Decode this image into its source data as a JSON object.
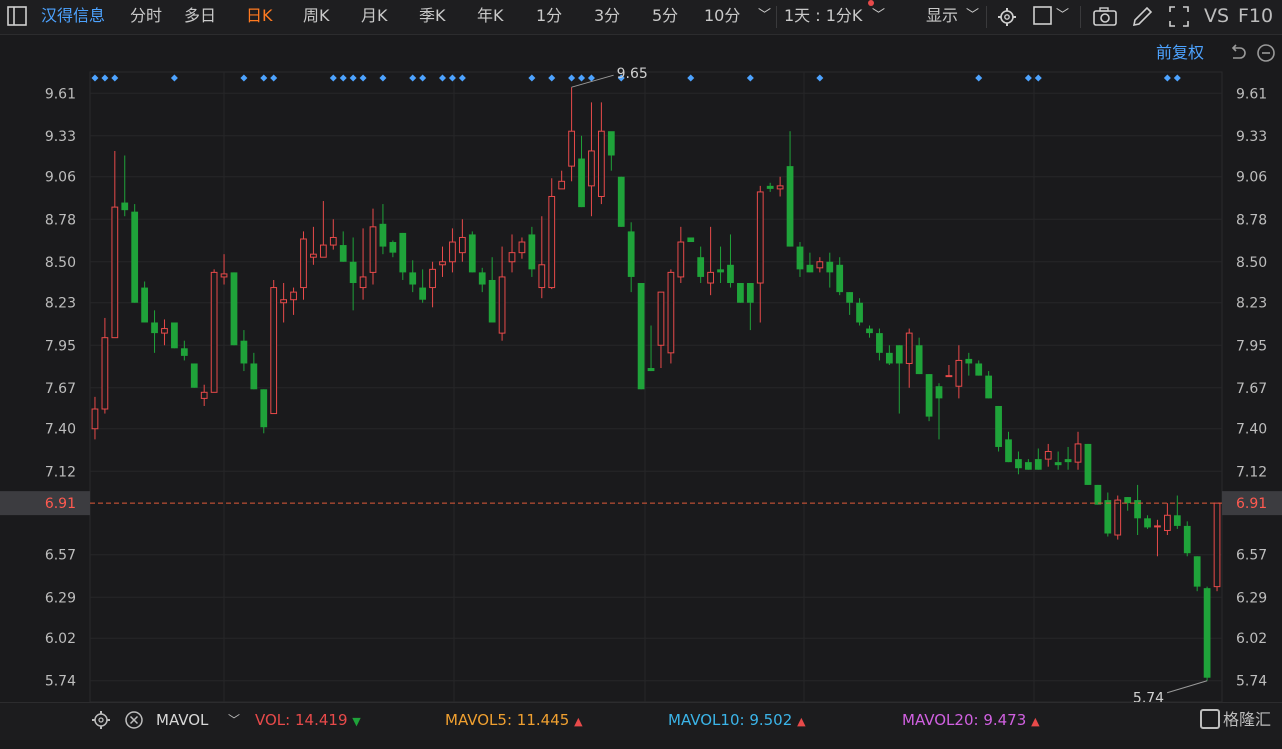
{
  "toolbar": {
    "stock_name": "汉得信息",
    "tabs": [
      "分时",
      "多日",
      "日K",
      "周K",
      "月K",
      "季K",
      "年K",
      "1分",
      "3分",
      "5分",
      "10分"
    ],
    "active_tab": "日K",
    "period_select": "1天 : 1分K",
    "display_label": "显示",
    "vs_label": "VS",
    "f10_label": "F10"
  },
  "subbar": {
    "adjust_label": "前复权"
  },
  "colors": {
    "up": "#e84a4a",
    "down": "#1fa33a",
    "active_tab": "#ff7a20",
    "accent": "#4da3ff",
    "price_line": "#e05a3a",
    "mavol5": "#f0a030",
    "mavol10": "#3bb4e8",
    "mavol20": "#d060e0"
  },
  "chart_data": {
    "type": "candlestick",
    "yaxis_ticks": [
      "9.61",
      "9.33",
      "9.06",
      "8.78",
      "8.50",
      "8.23",
      "7.95",
      "7.67",
      "7.40",
      "7.12",
      "6.57",
      "6.29",
      "6.02",
      "5.74"
    ],
    "ylim": [
      5.6,
      9.75
    ],
    "current_price": "6.91",
    "high_label": "9.65",
    "low_label": "5.74",
    "candles": [
      [
        7.4,
        7.53,
        7.33,
        7.61
      ],
      [
        7.53,
        8.0,
        7.5,
        8.13
      ],
      [
        8.0,
        8.86,
        8.0,
        9.23
      ],
      [
        8.89,
        8.84,
        8.8,
        9.2
      ],
      [
        8.83,
        8.23,
        8.23,
        8.88
      ],
      [
        8.33,
        8.1,
        8.1,
        8.37
      ],
      [
        8.1,
        8.03,
        7.9,
        8.18
      ],
      [
        8.03,
        8.06,
        7.95,
        8.12
      ],
      [
        8.1,
        7.93,
        7.93,
        8.1
      ],
      [
        7.93,
        7.88,
        7.85,
        7.98
      ],
      [
        7.83,
        7.67,
        7.67,
        7.83
      ],
      [
        7.6,
        7.64,
        7.55,
        7.69
      ],
      [
        7.64,
        8.43,
        7.64,
        8.45
      ],
      [
        8.4,
        8.42,
        8.35,
        8.55
      ],
      [
        8.43,
        7.95,
        7.95,
        8.43
      ],
      [
        7.98,
        7.83,
        7.78,
        8.05
      ],
      [
        7.83,
        7.66,
        7.66,
        7.9
      ],
      [
        7.66,
        7.41,
        7.37,
        7.66
      ],
      [
        7.5,
        8.33,
        7.5,
        8.38
      ],
      [
        8.23,
        8.25,
        8.1,
        8.36
      ],
      [
        8.25,
        8.3,
        8.15,
        8.33
      ],
      [
        8.33,
        8.65,
        8.25,
        8.7
      ],
      [
        8.53,
        8.55,
        8.48,
        8.73
      ],
      [
        8.53,
        8.61,
        8.53,
        8.9
      ],
      [
        8.61,
        8.66,
        8.58,
        8.78
      ],
      [
        8.61,
        8.5,
        8.5,
        8.7
      ],
      [
        8.5,
        8.36,
        8.18,
        8.66
      ],
      [
        8.33,
        8.4,
        8.25,
        8.72
      ],
      [
        8.43,
        8.73,
        8.35,
        8.85
      ],
      [
        8.75,
        8.6,
        8.55,
        8.88
      ],
      [
        8.63,
        8.56,
        8.53,
        8.64
      ],
      [
        8.69,
        8.43,
        8.38,
        8.69
      ],
      [
        8.43,
        8.35,
        8.3,
        8.51
      ],
      [
        8.33,
        8.25,
        8.23,
        8.45
      ],
      [
        8.33,
        8.45,
        8.2,
        8.5
      ],
      [
        8.48,
        8.5,
        8.4,
        8.6
      ],
      [
        8.5,
        8.63,
        8.43,
        8.72
      ],
      [
        8.56,
        8.66,
        8.5,
        8.78
      ],
      [
        8.68,
        8.43,
        8.43,
        8.7
      ],
      [
        8.43,
        8.35,
        8.3,
        8.46
      ],
      [
        8.38,
        8.1,
        8.1,
        8.53
      ],
      [
        8.03,
        8.4,
        7.98,
        8.6
      ],
      [
        8.5,
        8.56,
        8.43,
        8.68
      ],
      [
        8.56,
        8.63,
        8.52,
        8.66
      ],
      [
        8.68,
        8.45,
        8.4,
        8.73
      ],
      [
        8.33,
        8.48,
        8.26,
        8.8
      ],
      [
        8.33,
        8.93,
        8.32,
        9.05
      ],
      [
        8.98,
        9.03,
        8.98,
        9.1
      ],
      [
        9.13,
        9.36,
        9.03,
        9.65
      ],
      [
        9.18,
        8.86,
        8.86,
        9.33
      ],
      [
        9.0,
        9.23,
        8.8,
        9.55
      ],
      [
        8.93,
        9.36,
        8.88,
        9.55
      ],
      [
        9.36,
        9.2,
        9.1,
        9.2
      ],
      [
        9.06,
        8.73,
        8.73,
        9.06
      ],
      [
        8.7,
        8.4,
        8.3,
        8.76
      ],
      [
        8.36,
        7.66,
        7.66,
        8.36
      ],
      [
        7.8,
        7.78,
        7.78,
        8.08
      ],
      [
        7.95,
        8.3,
        7.8,
        8.3
      ],
      [
        7.9,
        8.43,
        7.83,
        8.45
      ],
      [
        8.4,
        8.63,
        8.36,
        8.73
      ],
      [
        8.66,
        8.63,
        8.63,
        8.65
      ],
      [
        8.53,
        8.4,
        8.36,
        8.6
      ],
      [
        8.36,
        8.43,
        8.28,
        8.73
      ],
      [
        8.45,
        8.43,
        8.36,
        8.6
      ],
      [
        8.48,
        8.36,
        8.33,
        8.68
      ],
      [
        8.36,
        8.23,
        8.23,
        8.36
      ],
      [
        8.36,
        8.23,
        8.05,
        8.36
      ],
      [
        8.36,
        8.96,
        8.1,
        9.0
      ],
      [
        9.0,
        8.98,
        8.96,
        9.02
      ],
      [
        8.98,
        9.0,
        8.93,
        9.06
      ],
      [
        9.13,
        8.6,
        8.6,
        9.36
      ],
      [
        8.6,
        8.45,
        8.4,
        8.63
      ],
      [
        8.48,
        8.43,
        8.43,
        8.56
      ],
      [
        8.46,
        8.5,
        8.43,
        8.53
      ],
      [
        8.5,
        8.43,
        8.33,
        8.56
      ],
      [
        8.48,
        8.3,
        8.28,
        8.53
      ],
      [
        8.3,
        8.23,
        8.15,
        8.3
      ],
      [
        8.23,
        8.1,
        8.08,
        8.26
      ],
      [
        8.06,
        8.03,
        8.0,
        8.08
      ],
      [
        8.03,
        7.9,
        7.85,
        8.06
      ],
      [
        7.9,
        7.83,
        7.82,
        7.95
      ],
      [
        7.95,
        7.83,
        7.5,
        7.95
      ],
      [
        7.83,
        8.03,
        7.67,
        8.06
      ],
      [
        7.95,
        7.76,
        7.76,
        8.0
      ],
      [
        7.76,
        7.48,
        7.45,
        7.76
      ],
      [
        7.68,
        7.6,
        7.33,
        7.7
      ],
      [
        7.75,
        7.75,
        7.75,
        7.82
      ],
      [
        7.68,
        7.85,
        7.6,
        7.95
      ],
      [
        7.86,
        7.83,
        7.75,
        7.9
      ],
      [
        7.83,
        7.75,
        7.75,
        7.85
      ],
      [
        7.75,
        7.6,
        7.6,
        7.78
      ],
      [
        7.55,
        7.28,
        7.25,
        7.55
      ],
      [
        7.33,
        7.18,
        7.18,
        7.38
      ],
      [
        7.2,
        7.14,
        7.1,
        7.25
      ],
      [
        7.18,
        7.13,
        7.13,
        7.2
      ],
      [
        7.2,
        7.13,
        7.13,
        7.27
      ],
      [
        7.2,
        7.25,
        7.15,
        7.3
      ],
      [
        7.18,
        7.16,
        7.13,
        7.25
      ],
      [
        7.2,
        7.18,
        7.13,
        7.28
      ],
      [
        7.18,
        7.3,
        7.13,
        7.38
      ],
      [
        7.3,
        7.03,
        7.03,
        7.3
      ],
      [
        7.03,
        6.9,
        6.9,
        7.03
      ],
      [
        6.93,
        6.71,
        6.69,
        6.98
      ],
      [
        6.7,
        6.93,
        6.67,
        6.96
      ],
      [
        6.95,
        6.91,
        6.86,
        6.95
      ],
      [
        6.93,
        6.81,
        6.7,
        7.03
      ],
      [
        6.81,
        6.75,
        6.74,
        6.83
      ],
      [
        6.76,
        6.76,
        6.56,
        6.8
      ],
      [
        6.73,
        6.83,
        6.7,
        6.91
      ],
      [
        6.83,
        6.76,
        6.74,
        6.96
      ],
      [
        6.76,
        6.58,
        6.56,
        6.79
      ],
      [
        6.56,
        6.36,
        6.33,
        6.56
      ],
      [
        6.35,
        5.76,
        5.74,
        6.36
      ],
      [
        6.36,
        6.91,
        6.33,
        6.91
      ]
    ],
    "event_markers_index": [
      0,
      1,
      2,
      8,
      15,
      17,
      18,
      24,
      25,
      26,
      27,
      29,
      32,
      33,
      35,
      36,
      37,
      44,
      46,
      48,
      49,
      50,
      53,
      60,
      66,
      73,
      89,
      94,
      95,
      108,
      109
    ]
  },
  "volume": {
    "indicator": "MAVOL",
    "vol_label": "VOL:",
    "vol_value": "14.419",
    "mavol5_label": "MAVOL5:",
    "mavol5_value": "11.445",
    "mavol10_label": "MAVOL10:",
    "mavol10_value": "9.502",
    "mavol20_label": "MAVOL20:",
    "mavol20_value": "9.473",
    "watermark": "格隆汇"
  }
}
